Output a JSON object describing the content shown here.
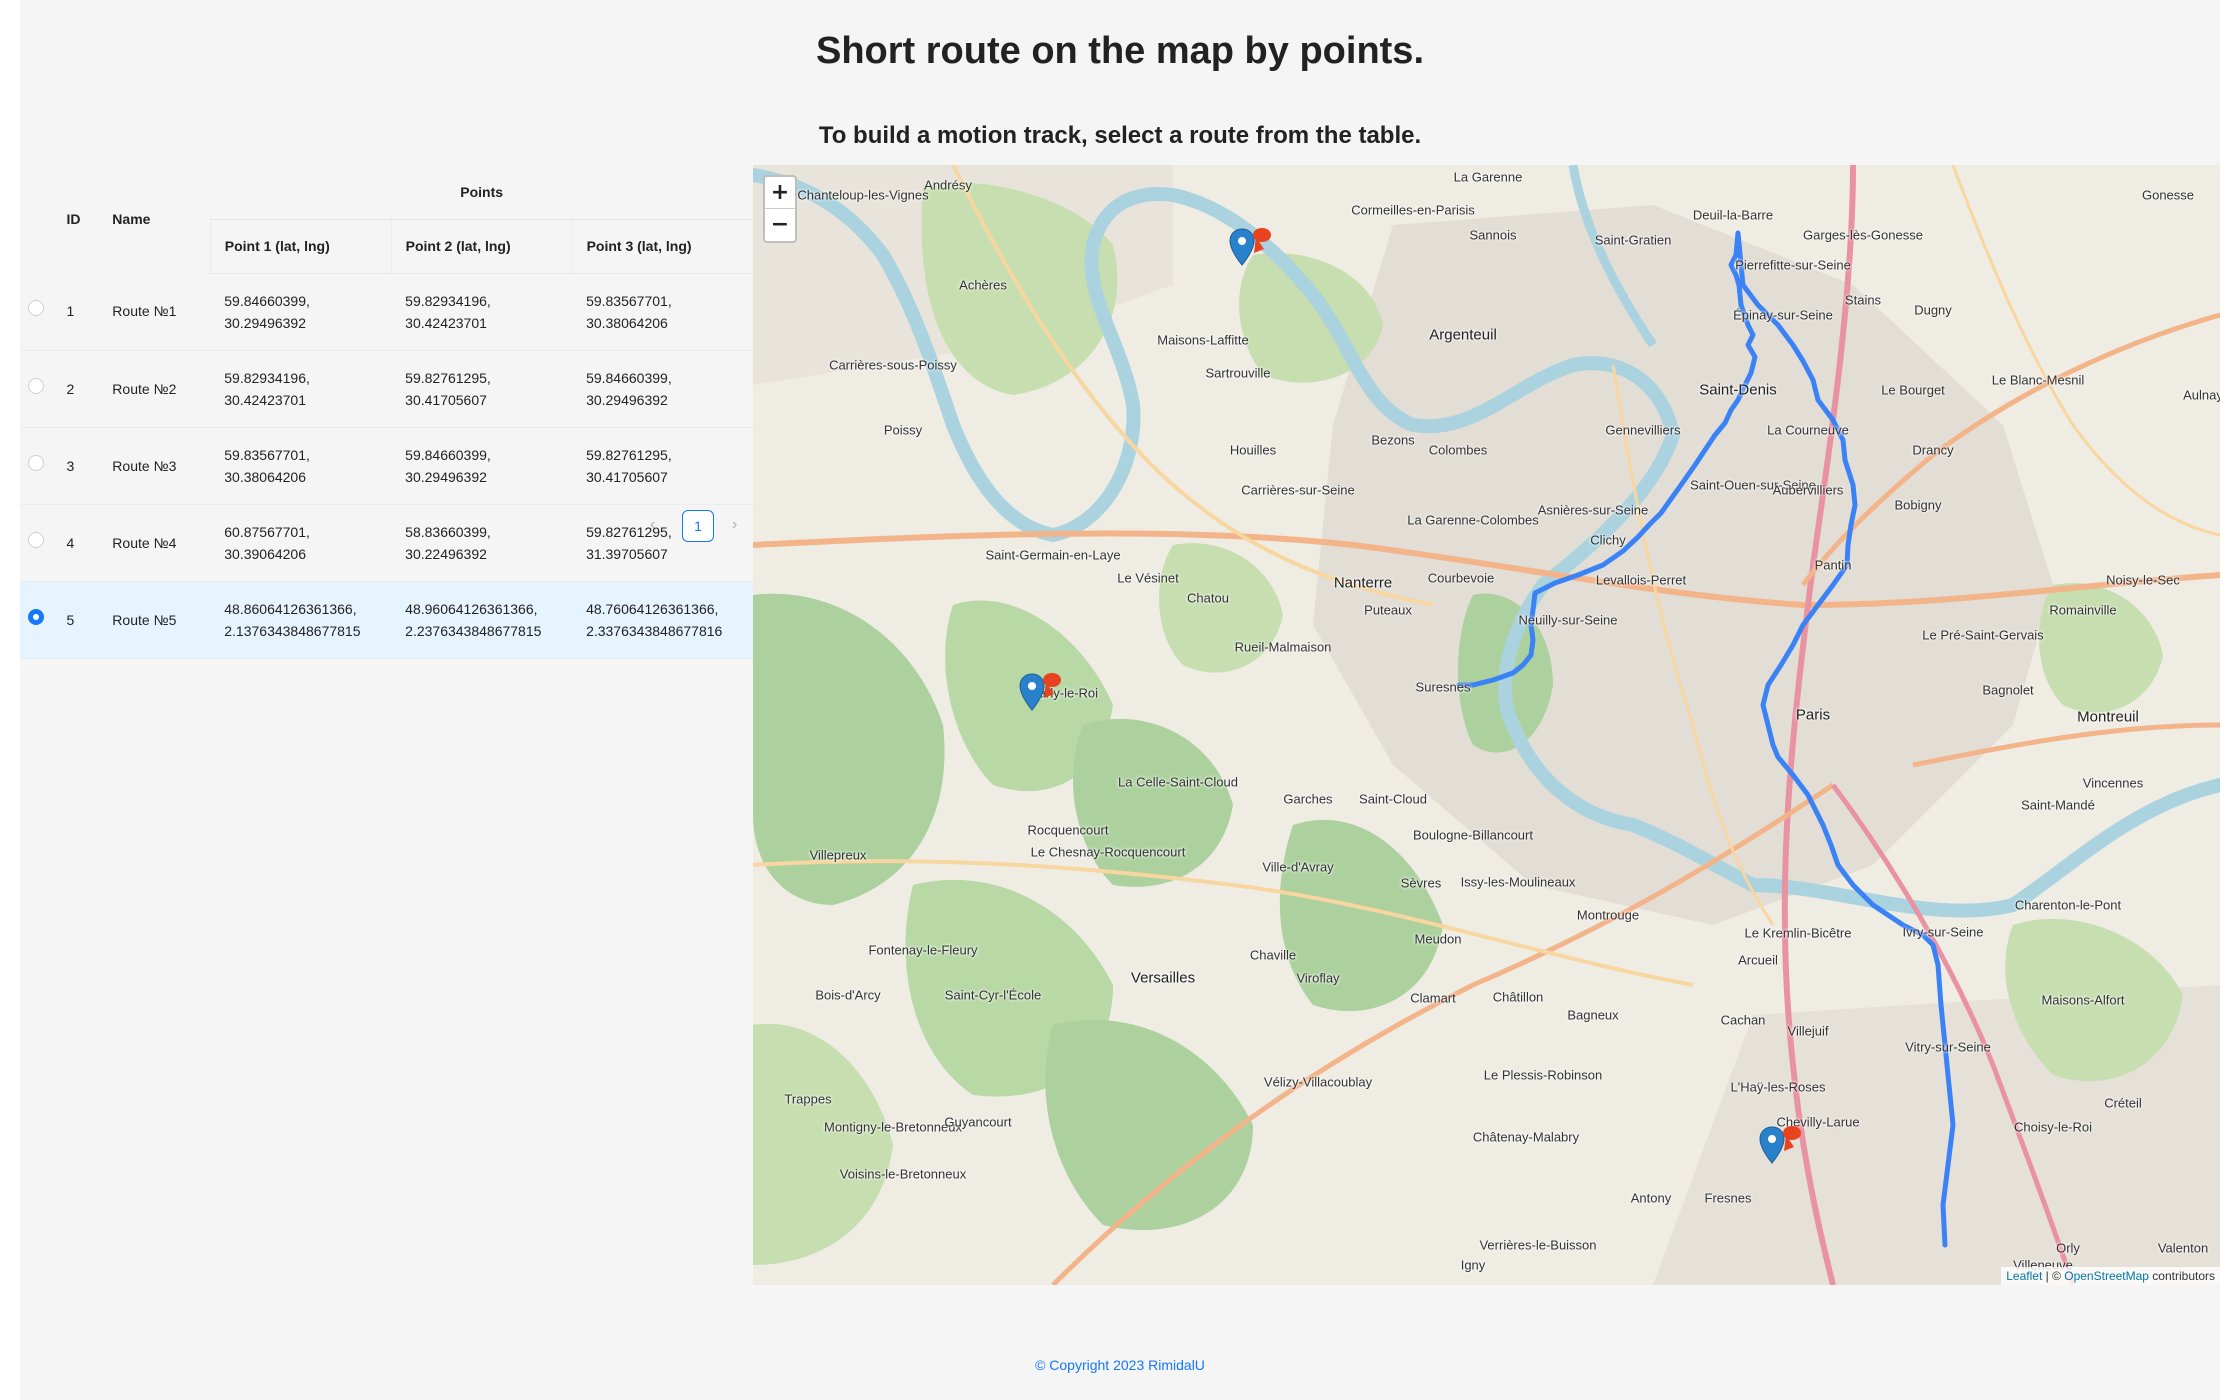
{
  "header": {
    "title": "Short route on the map by points.",
    "subtitle": "To build a motion track, select a route from the table."
  },
  "table": {
    "columns": {
      "id": "ID",
      "name": "Name",
      "points": "Points",
      "point1": "Point 1 (lat, lng)",
      "point2": "Point 2 (lat, lng)",
      "point3": "Point 3 (lat, lng)"
    },
    "rows": [
      {
        "id": "1",
        "name": "Route №1",
        "p1a": "59.84660399,",
        "p1b": "30.29496392",
        "p2a": "59.82934196,",
        "p2b": "30.42423701",
        "p3a": "59.83567701,",
        "p3b": "30.38064206",
        "selected": false
      },
      {
        "id": "2",
        "name": "Route №2",
        "p1a": "59.82934196,",
        "p1b": "30.42423701",
        "p2a": "59.82761295,",
        "p2b": "30.41705607",
        "p3a": "59.84660399,",
        "p3b": "30.29496392",
        "selected": false
      },
      {
        "id": "3",
        "name": "Route №3",
        "p1a": "59.83567701,",
        "p1b": "30.38064206",
        "p2a": "59.84660399,",
        "p2b": "30.29496392",
        "p3a": "59.82761295,",
        "p3b": "30.41705607",
        "selected": false
      },
      {
        "id": "4",
        "name": "Route №4",
        "p1a": "60.87567701,",
        "p1b": "30.39064206",
        "p2a": "58.83660399,",
        "p2b": "30.22496392",
        "p3a": "59.82761295,",
        "p3b": "31.39705607",
        "selected": false
      },
      {
        "id": "5",
        "name": "Route №5",
        "p1a": "48.86064126361366,",
        "p1b": "2.1376343848677815",
        "p2a": "48.96064126361366,",
        "p2b": "2.2376343848677815",
        "p3a": "48.76064126361366,",
        "p3b": "2.3376343848677816",
        "selected": true
      }
    ]
  },
  "pagination": {
    "prev": "‹",
    "current": "1",
    "next": "›"
  },
  "map": {
    "zoom_in": "+",
    "zoom_out": "−",
    "attribution_leaflet": "Leaflet",
    "attribution_sep": " | © ",
    "attribution_osm": "OpenStreetMap",
    "attribution_tail": " contributors",
    "route_color": "#3b82f6",
    "marker_color": "#2a81cb",
    "pin_color": "#e8421e",
    "places": [
      "Chanteloup-les-Vignes",
      "Andrésy",
      "La Garenne",
      "Cormeilles-en-Parisis",
      "Sannois",
      "Saint-Gratien",
      "Deuil-la-Barre",
      "Pierrefitte-sur-Seine",
      "Garges-lès-Gonesse",
      "Achères",
      "Argenteuil",
      "Épinay-sur-Seine",
      "Stains",
      "Dugny",
      "Maisons-Laffitte",
      "Sartrouville",
      "Carrières-sous-Poissy",
      "Saint-Denis",
      "Le Bourget",
      "Le Blanc-Mesnil",
      "Poissy",
      "Bezons",
      "Gennevilliers",
      "La Courneuve",
      "Drancy",
      "Houilles",
      "Colombes",
      "Saint-Ouen-sur-Seine",
      "Aubervilliers",
      "Bobigny",
      "Carrières-sur-Seine",
      "Asnières-sur-Seine",
      "Saint-Germain-en-Laye",
      "La Garenne-Colombes",
      "Clichy",
      "Pantin",
      "Le Vésinet",
      "Nanterre",
      "Courbevoie",
      "Levallois-Perret",
      "Noisy-le-Sec",
      "Chatou",
      "Puteaux",
      "Neuilly-sur-Seine",
      "Le Pré-Saint-Gervais",
      "Romainville",
      "Rueil-Malmaison",
      "Paris",
      "Montreuil",
      "Bagnolet",
      "Marly-le-Roi",
      "Suresnes",
      "La Celle-Saint-Cloud",
      "Garches",
      "Saint-Cloud",
      "Boulogne-Billancourt",
      "Vincennes",
      "Saint-Mandé",
      "Rocquencourt",
      "Le Chesnay-Rocquencourt",
      "Ville-d'Avray",
      "Sèvres",
      "Issy-les-Moulineaux",
      "Montrouge",
      "Charenton-le-Pont",
      "Villepreux",
      "Le Kremlin-Bicêtre",
      "Ivry-sur-Seine",
      "Fontenay-le-Fleury",
      "Chaville",
      "Meudon",
      "Arcueil",
      "Versailles",
      "Viroflay",
      "Saint-Cyr-l'École",
      "Bois-d'Arcy",
      "Clamart",
      "Châtillon",
      "Bagneux",
      "Cachan",
      "Villejuif",
      "Maisons-Alfort",
      "Vitry-sur-Seine",
      "Vélizy-Villacoublay",
      "Le Plessis-Robinson",
      "L'Haÿ-les-Roses",
      "Trappes",
      "Montigny-le-Bretonneux",
      "Guyancourt",
      "Châtenay-Malabry",
      "Chevilly-Larue",
      "Choisy-le-Roi",
      "Créteil",
      "Voisins-le-Bretonneux",
      "Antony",
      "Fresnes",
      "Verrières-le-Buisson",
      "Orly",
      "Valenton",
      "Igny",
      "Villeneuve",
      "Gonesse",
      "Aulnay"
    ]
  },
  "footer": {
    "copyright": "© Copyright 2023 RimidalU"
  }
}
